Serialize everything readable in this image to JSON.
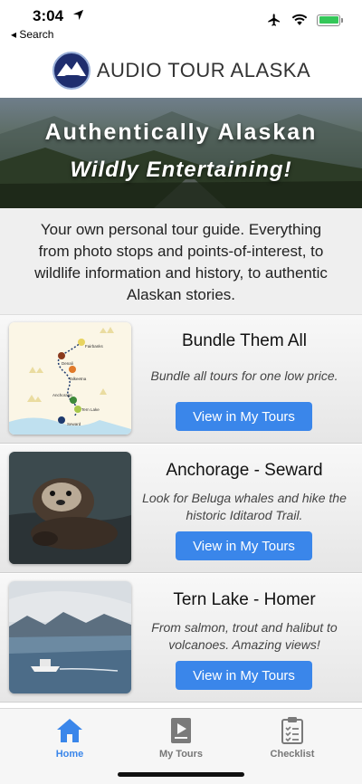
{
  "status": {
    "time": "3:04",
    "back_label": "◂ Search",
    "battery_color": "#34c759"
  },
  "header": {
    "title": "AUDIO TOUR ALASKA",
    "logo_icon": "bear-mountain-logo"
  },
  "hero": {
    "title": "Authentically Alaskan",
    "subtitle": "Wildly Entertaining!"
  },
  "intro": {
    "text": "Your own personal tour guide. Everything from photo stops and points-of-interest, to wildlife information and history, to authentic Alaskan stories."
  },
  "tours": [
    {
      "title": "Bundle Them All",
      "description": "Bundle all tours for one low price.",
      "button": "View in My Tours",
      "thumb": "route-map",
      "map_labels": [
        "Fairbanks",
        "Denali",
        "Talkeetna",
        "Anchorage",
        "Tern Lake",
        "Seward"
      ]
    },
    {
      "title": "Anchorage - Seward",
      "description": "Look for Beluga whales and hike the historic Iditarod Trail.",
      "button": "View in My Tours",
      "thumb": "sea-otter-photo"
    },
    {
      "title": "Tern Lake - Homer",
      "description": "From salmon, trout and halibut to volcanoes. Amazing views!",
      "button": "View in My Tours",
      "thumb": "boat-mountains-photo"
    }
  ],
  "tabbar": {
    "items": [
      {
        "label": "Home",
        "icon": "home-icon",
        "active": true
      },
      {
        "label": "My Tours",
        "icon": "play-document-icon",
        "active": false
      },
      {
        "label": "Checklist",
        "icon": "clipboard-checklist-icon",
        "active": false
      }
    ],
    "accent": "#3a86ea"
  }
}
